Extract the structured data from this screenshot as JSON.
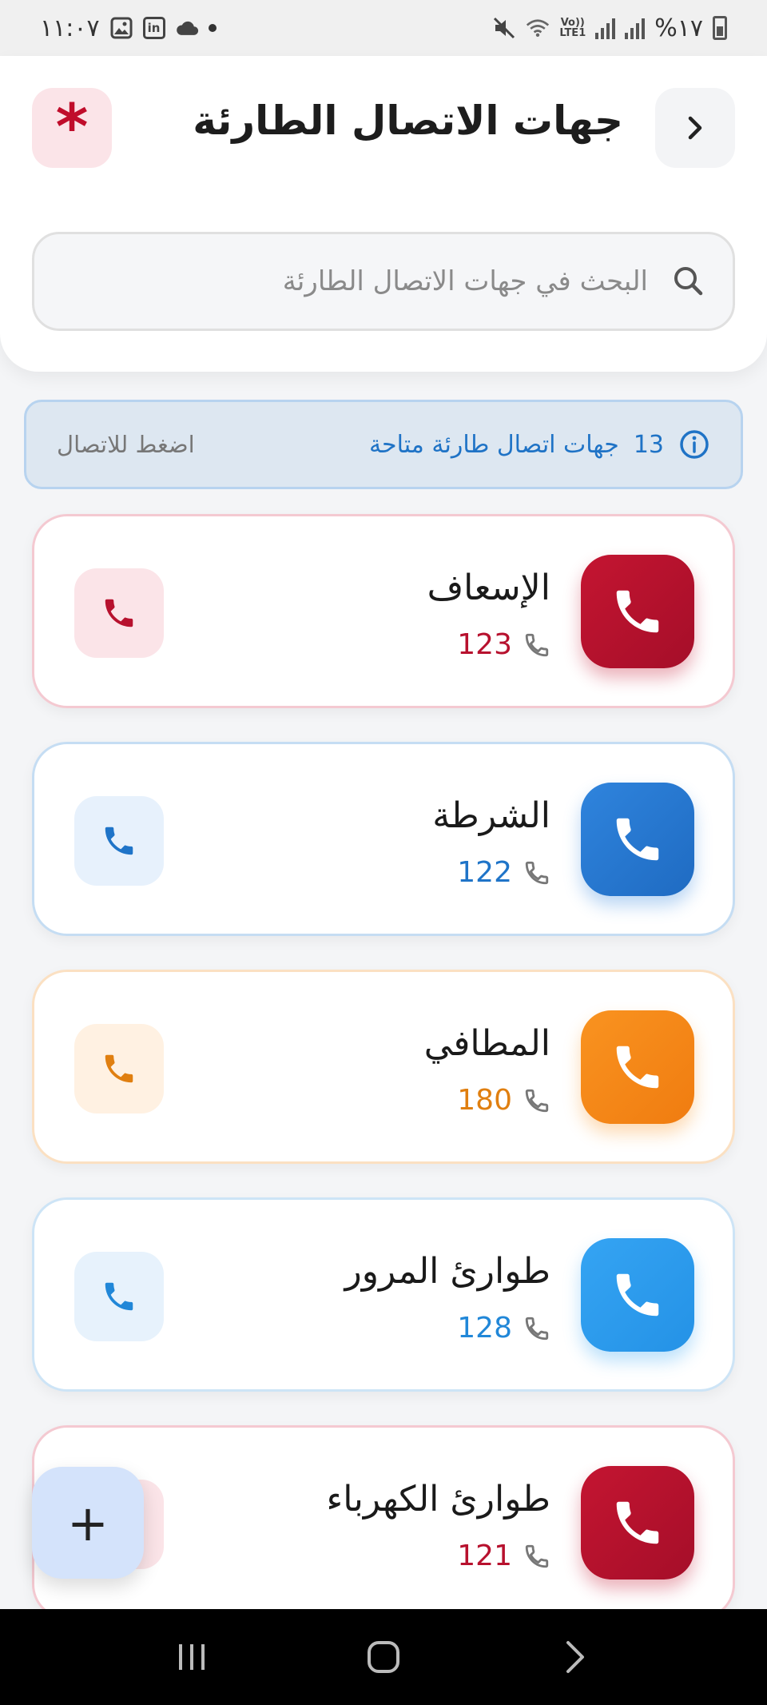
{
  "status_bar": {
    "battery": "%١٧",
    "lte_top": "Vo))",
    "lte_bottom": "LTE1",
    "linkedin": "in",
    "time": "١١:٠٧"
  },
  "header": {
    "title": "جهات الاتصال الطارئة",
    "badge_symbol": "*",
    "search_placeholder": "البحث في جهات الاتصال الطارئة"
  },
  "info_banner": {
    "count": "13",
    "label": "جهات اتصال طارئة متاحة",
    "hint": "اضغط للاتصال"
  },
  "contacts": [
    {
      "name": "الإسعاف",
      "number": "123",
      "accent": "#b7112e",
      "tile_from": "#c41531",
      "tile_to": "#a50e29",
      "call_bg": "#fbe4e8",
      "border": "#f4c9d1"
    },
    {
      "name": "الشرطة",
      "number": "122",
      "accent": "#1f74c8",
      "tile_from": "#2f84dd",
      "tile_to": "#1f6bc2",
      "call_bg": "#e7f1fc",
      "border": "#c5ddf3"
    },
    {
      "name": "المطافي",
      "number": "180",
      "accent": "#e07f10",
      "tile_from": "#f99320",
      "tile_to": "#f07c10",
      "call_bg": "#fff1e2",
      "border": "#fbe0c2"
    },
    {
      "name": "طوارئ المرور",
      "number": "128",
      "accent": "#2187d8",
      "tile_from": "#35a4f3",
      "tile_to": "#2492e6",
      "call_bg": "#e7f2fc",
      "border": "#cde4f6"
    },
    {
      "name": "طوارئ الكهرباء",
      "number": "121",
      "accent": "#b7112e",
      "tile_from": "#c41531",
      "tile_to": "#a50e29",
      "call_bg": "#fbe4e8",
      "border": "#f4c9d1"
    }
  ],
  "fab": {
    "symbol": "+"
  }
}
